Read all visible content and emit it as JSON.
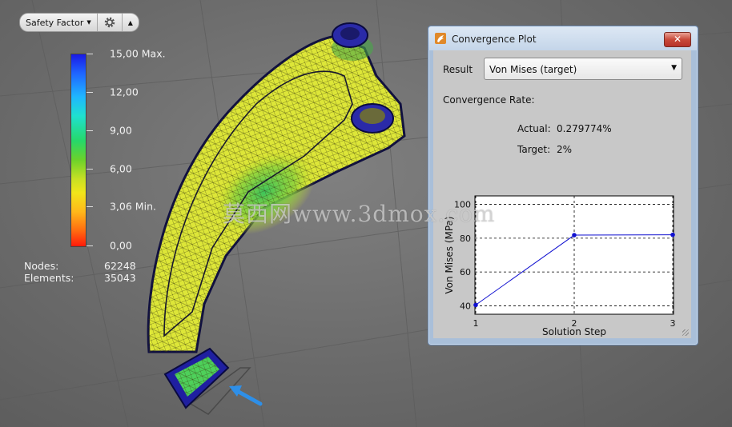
{
  "result_bar": {
    "result_label": "Safety Factor",
    "settings_icon": "gear-icon",
    "collapse_icon": "triangle-up-icon"
  },
  "legend": {
    "labels": [
      "15,00 Max.",
      "12,00",
      "9,00",
      "6,00",
      "3,06 Min.",
      "0,00"
    ],
    "nodes_label": "Nodes:",
    "nodes_value": "62248",
    "elements_label": "Elements:",
    "elements_value": "35043"
  },
  "dialog": {
    "title": "Convergence Plot",
    "close_label": "✕",
    "result_label": "Result",
    "result_value": "Von Mises (target)",
    "convergence_rate_label": "Convergence Rate:",
    "actual_label": "Actual:",
    "actual_value": "0.279774%",
    "target_label": "Target:",
    "target_value": "2%"
  },
  "chart_data": {
    "type": "line",
    "x": [
      1,
      2,
      3
    ],
    "series": [
      {
        "values": [
          40.5,
          81.8,
          82.0
        ],
        "color": "#1010d0"
      }
    ],
    "xlabel": "Solution Step",
    "ylabel": "Von Mises (MPa)",
    "xticks": [
      "1",
      "2",
      "3"
    ],
    "yticks": [
      "40",
      "60",
      "80",
      "100"
    ],
    "xlim": [
      1,
      3
    ],
    "ylim": [
      35,
      105
    ],
    "grid": true
  },
  "watermark": "莫西网www.3dmox.com"
}
